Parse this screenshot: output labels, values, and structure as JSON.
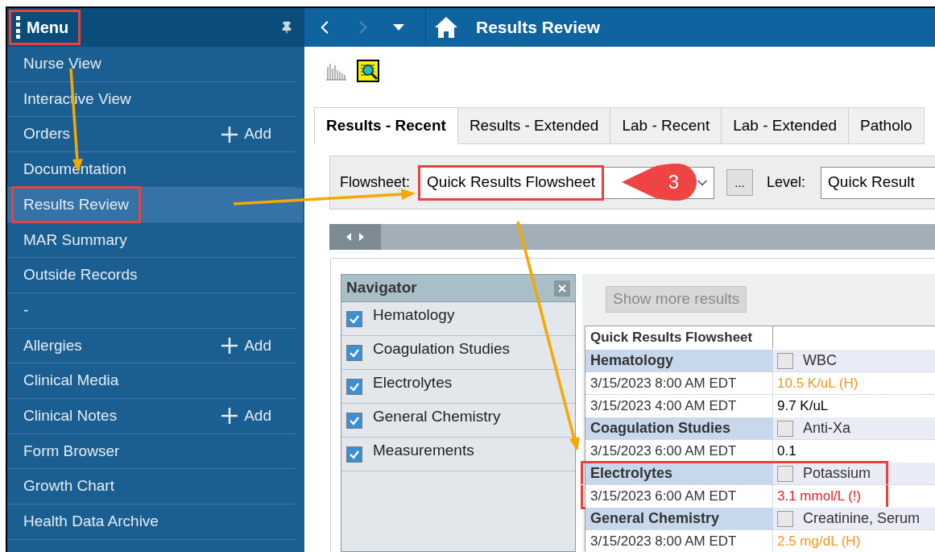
{
  "menu": {
    "title": "Menu",
    "highlighted": true
  },
  "sidebar": {
    "items": [
      {
        "label": "Nurse View",
        "selected": false,
        "highlighted": false
      },
      {
        "label": "Interactive View",
        "selected": false,
        "highlighted": false
      },
      {
        "label": "Orders",
        "selected": false,
        "highlighted": false,
        "add": "Add"
      },
      {
        "label": "Documentation",
        "selected": false,
        "highlighted": false
      },
      {
        "label": "Results Review",
        "selected": true,
        "highlighted": true
      },
      {
        "label": "MAR Summary",
        "selected": false,
        "highlighted": false
      },
      {
        "label": "Outside Records",
        "selected": false,
        "highlighted": false
      },
      {
        "label": "-",
        "selected": false,
        "highlighted": false
      },
      {
        "label": "Allergies",
        "selected": false,
        "highlighted": false,
        "add": "Add"
      },
      {
        "label": "Clinical Media",
        "selected": false,
        "highlighted": false
      },
      {
        "label": "Clinical Notes",
        "selected": false,
        "highlighted": false,
        "add": "Add"
      },
      {
        "label": "Form Browser",
        "selected": false,
        "highlighted": false
      },
      {
        "label": "Growth Chart",
        "selected": false,
        "highlighted": false
      },
      {
        "label": "Health Data Archive",
        "selected": false,
        "highlighted": false
      }
    ]
  },
  "header": {
    "title": "Results Review"
  },
  "tabs": [
    {
      "label": "Results - Recent",
      "selected": true
    },
    {
      "label": "Results - Extended",
      "selected": false
    },
    {
      "label": "Lab - Recent",
      "selected": false
    },
    {
      "label": "Lab - Extended",
      "selected": false
    },
    {
      "label": "Patholo",
      "selected": false
    }
  ],
  "flowsheet": {
    "label": "Flowsheet:",
    "value": "Quick Results Flowsheet",
    "highlighted": true,
    "more_button": "...",
    "level_label": "Level:",
    "level_value": "Quick Result"
  },
  "callout": {
    "text": "3"
  },
  "navigator": {
    "title": "Navigator",
    "items": [
      {
        "label": "Hematology",
        "checked": true
      },
      {
        "label": "Coagulation Studies",
        "checked": true
      },
      {
        "label": "Electrolytes",
        "checked": true
      },
      {
        "label": "General Chemistry",
        "checked": true
      },
      {
        "label": "Measurements",
        "checked": true
      }
    ]
  },
  "results": {
    "show_more": "Show more results",
    "show_more_disabled": true,
    "column_header": "Quick Results Flowsheet",
    "rows": [
      {
        "kind": "group",
        "name": "Hematology",
        "test": "WBC",
        "checked": false,
        "highlighted": false
      },
      {
        "kind": "result",
        "time": "3/15/2023 8:00 AM EDT",
        "value": "10.5 K/uL (H)",
        "color": "#f7941d",
        "highlighted": false
      },
      {
        "kind": "result",
        "time": "3/15/2023 4:00 AM EDT",
        "value": "9.7 K/uL",
        "color": "#000000",
        "highlighted": false
      },
      {
        "kind": "group",
        "name": "Coagulation Studies",
        "test": "Anti-Xa",
        "checked": false,
        "highlighted": false
      },
      {
        "kind": "result",
        "time": "3/15/2023 6:00 AM EDT",
        "value": "0.1",
        "color": "#000000",
        "highlighted": false
      },
      {
        "kind": "group",
        "name": "Electrolytes",
        "test": "Potassium",
        "checked": false,
        "highlighted": true
      },
      {
        "kind": "result",
        "time": "3/15/2023 6:00 AM EDT",
        "value": "3.1 mmol/L (!)",
        "color": "#ee1c25",
        "highlighted": true
      },
      {
        "kind": "group",
        "name": "General Chemistry",
        "test": "Creatinine, Serum",
        "checked": false,
        "highlighted": false
      },
      {
        "kind": "result",
        "time": "3/15/2023 8:00 AM EDT",
        "value": "2.5 mg/dL (H)",
        "color": "#f7941d",
        "highlighted": false
      }
    ]
  }
}
